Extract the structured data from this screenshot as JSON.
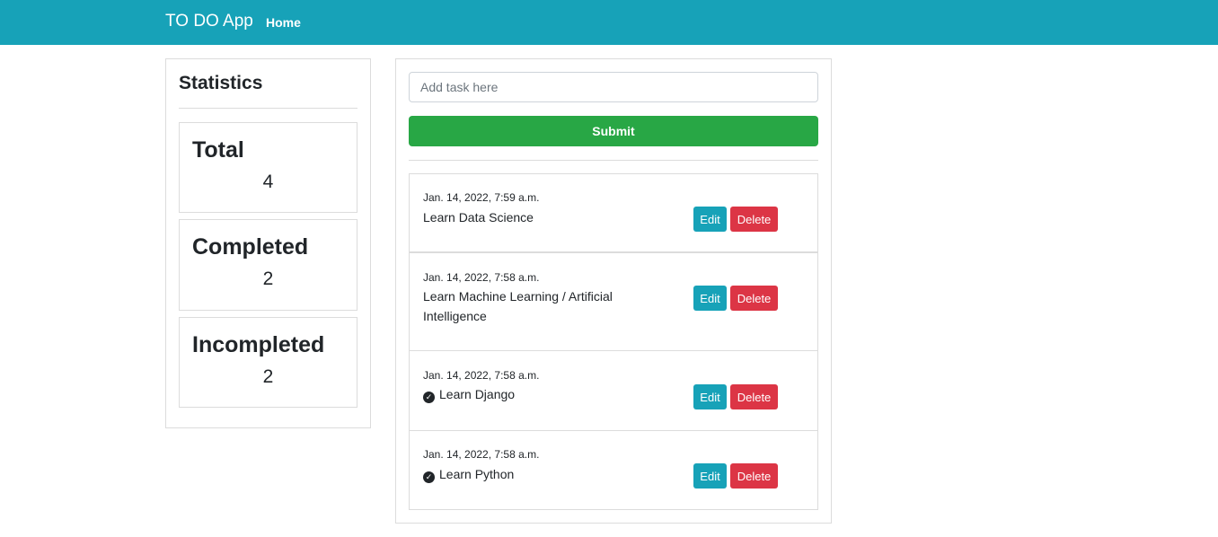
{
  "navbar": {
    "brand": "TO DO App",
    "home_link": "Home"
  },
  "statistics": {
    "title": "Statistics",
    "items": [
      {
        "label": "Total",
        "value": "4"
      },
      {
        "label": "Completed",
        "value": "2"
      },
      {
        "label": "Incompleted",
        "value": "2"
      }
    ]
  },
  "form": {
    "placeholder": "Add task here",
    "submit_label": "Submit"
  },
  "buttons": {
    "edit": "Edit",
    "delete": "Delete"
  },
  "tasks": [
    {
      "date": "Jan. 14, 2022, 7:59 a.m.",
      "title": "Learn Data Science",
      "completed": false
    },
    {
      "date": "Jan. 14, 2022, 7:58 a.m.",
      "title": "Learn Machine Learning / Artificial Intelligence",
      "completed": false
    },
    {
      "date": "Jan. 14, 2022, 7:58 a.m.",
      "title": "Learn Django",
      "completed": true
    },
    {
      "date": "Jan. 14, 2022, 7:58 a.m.",
      "title": "Learn Python",
      "completed": true
    }
  ],
  "colors": {
    "navbar": "#17a2b8",
    "submit": "#28a745",
    "edit": "#17a2b8",
    "delete": "#dc3545"
  },
  "icons": {
    "completed": "check-circle-icon"
  }
}
